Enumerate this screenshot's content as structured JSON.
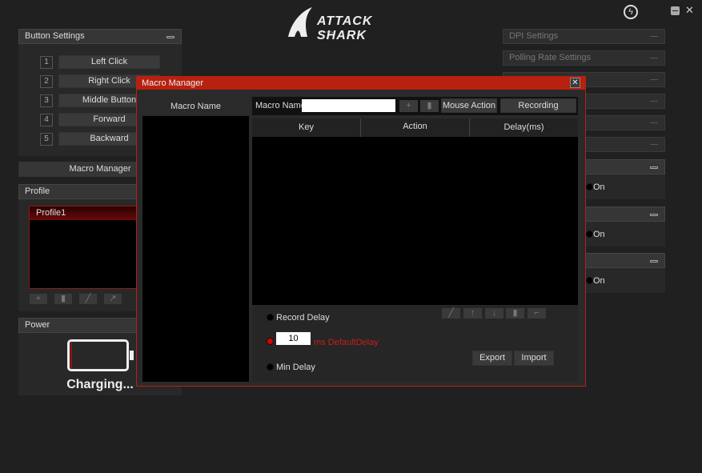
{
  "app": {
    "logo_text": "ATTACK SHARK"
  },
  "button_settings": {
    "title": "Button Settings",
    "buttons": [
      {
        "num": "1",
        "label": "Left Click"
      },
      {
        "num": "2",
        "label": "Right Click"
      },
      {
        "num": "3",
        "label": "Middle Button"
      },
      {
        "num": "4",
        "label": "Forward"
      },
      {
        "num": "5",
        "label": "Backward"
      }
    ]
  },
  "macro_manager_button": "Macro Manager",
  "profile": {
    "title": "Profile",
    "items": [
      "Profile1"
    ]
  },
  "power": {
    "title": "Power",
    "status": "Charging..."
  },
  "right_panels": {
    "dpi": "DPI Settings",
    "polling": "Polling Rate Settings",
    "toggles": [
      "On",
      "On",
      "On"
    ]
  },
  "modal": {
    "title": "Macro Manager",
    "list_header": "Macro Name",
    "name_label": "Macro Name",
    "name_value": "",
    "mouse_action": "Mouse Action",
    "recording": "Recording",
    "columns": [
      "Key",
      "Action",
      "Delay(ms)"
    ],
    "record_delay": "Record Delay",
    "delay_value": "10",
    "default_delay": "ms DefaultDelay",
    "min_delay": "Min Delay",
    "export": "Export",
    "import": "Import"
  },
  "colors": {
    "accent": "#b8200f",
    "bg": "#202020"
  }
}
